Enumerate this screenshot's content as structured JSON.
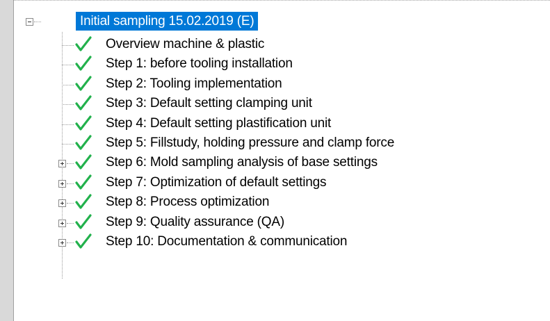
{
  "tree": {
    "root": {
      "label": "Initial sampling  15.02.2019 (E)",
      "expanded": true,
      "selected": true,
      "selection_color": "#0078d7"
    },
    "items": [
      {
        "label": "Overview machine & plastic",
        "status_icon": "check-icon",
        "expandable": false
      },
      {
        "label": "Step 1: before tooling installation",
        "status_icon": "check-icon",
        "expandable": false
      },
      {
        "label": "Step 2: Tooling implementation",
        "status_icon": "check-icon",
        "expandable": false
      },
      {
        "label": "Step 3: Default setting clamping unit",
        "status_icon": "check-icon",
        "expandable": false
      },
      {
        "label": "Step 4: Default setting plastification unit",
        "status_icon": "check-icon",
        "expandable": false
      },
      {
        "label": "Step 5: Fillstudy, holding pressure and clamp force",
        "status_icon": "check-icon",
        "expandable": false
      },
      {
        "label": "Step 6: Mold sampling analysis of base settings",
        "status_icon": "check-icon",
        "expandable": true
      },
      {
        "label": "Step 7: Optimization of default settings",
        "status_icon": "check-icon",
        "expandable": true
      },
      {
        "label": "Step 8: Process optimization",
        "status_icon": "check-icon",
        "expandable": true
      },
      {
        "label": "Step 9: Quality assurance (QA)",
        "status_icon": "check-icon",
        "expandable": true
      },
      {
        "label": "Step 10: Documentation & communication",
        "status_icon": "check-icon",
        "expandable": true
      }
    ],
    "check_color": "#22b14c"
  }
}
